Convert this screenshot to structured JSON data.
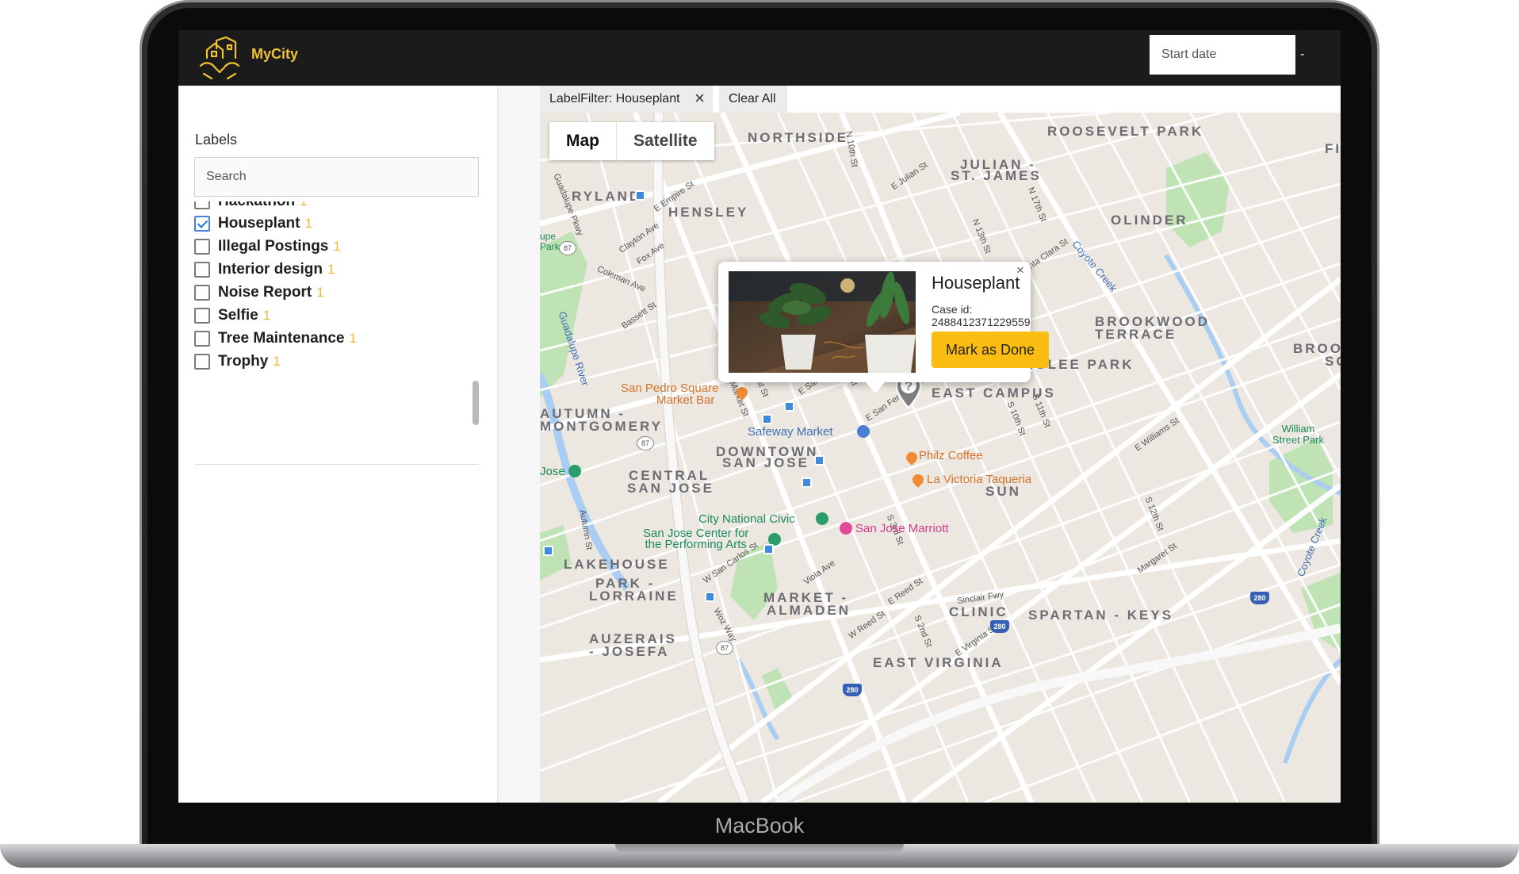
{
  "device": {
    "brand_label": "MacBook"
  },
  "header": {
    "app_name": "MyCity",
    "start_date_placeholder": "Start date",
    "date_separator": "-"
  },
  "sidebar": {
    "title": "Labels",
    "search_placeholder": "Search",
    "items": [
      {
        "label": "Hackathon",
        "count": "1",
        "checked": false
      },
      {
        "label": "Houseplant",
        "count": "1",
        "checked": true
      },
      {
        "label": "Illegal Postings",
        "count": "1",
        "checked": false
      },
      {
        "label": "Interior design",
        "count": "1",
        "checked": false
      },
      {
        "label": "Noise Report",
        "count": "1",
        "checked": false
      },
      {
        "label": "Selfie",
        "count": "1",
        "checked": false
      },
      {
        "label": "Tree Maintenance",
        "count": "1",
        "checked": false
      },
      {
        "label": "Trophy",
        "count": "1",
        "checked": false
      }
    ]
  },
  "filters": {
    "active_filter": "LabelFilter: Houseplant",
    "remove_icon": "×",
    "clear_all": "Clear All"
  },
  "map": {
    "map_type": {
      "map_label": "Map",
      "satellite_label": "Satellite",
      "selected": "Map"
    },
    "areas": [
      "NORTHSIDE",
      "ROOSEVELT PARK",
      "JULIAN -",
      "ST. JAMES",
      "RYLAND",
      "HENSLEY",
      "OLINDER",
      "BROOKWOOD",
      "TERRACE",
      "NAGLEE PARK",
      "EAST CAMPUS",
      "AUTUMN -",
      "MONTGOMERY",
      "DOWNTOWN",
      "SAN JOSE",
      "CENTRAL",
      "SAN JOSE",
      "SUN",
      "LAKEHOUSE",
      "PARK -",
      "LORRAINE",
      "MARKET -",
      "ALMADEN",
      "CLINIC",
      "SPARTAN - KEYS",
      "AUZERAIS",
      "- JOSEFA",
      "EAST VIRGINIA"
    ],
    "places": {
      "san_pedro_square": "San Pedro Square",
      "market_bar": "Market Bar",
      "safeway": "Safeway Market",
      "philz": "Philz Coffee",
      "la_victoria": "La Victoria Taqueria",
      "city_national": "City National Civic",
      "sj_center_1": "San Jose Center for",
      "sj_center_2": "the Performing Arts",
      "marriott": "San Jose Marriott",
      "william_park_1": "William",
      "william_park_2": "Street Park",
      "guadalupe_river": "Guadalupe River",
      "coyote_creek": "Coyote Creek",
      "coyote_creek_2": "Coyote Creek",
      "jose": "Jose",
      "park_partial": "upe Park",
      "brook_partial": "BROO",
      "so_partial": "SO",
      "fi_partial": "FI"
    },
    "streets": [
      "N 10th St",
      "E Julian St",
      "Guadalupe Pkwy",
      "E Empire St",
      "Clayton Ave",
      "Fox Ave",
      "Coleman Ave",
      "Bassett St",
      "Santa Clara St",
      "E Santa Clara St",
      "E San Fernando St",
      "N Market St",
      "N 1st St",
      "S 4th St",
      "S 10th St",
      "S 11th St",
      "E Williams St",
      "S 3rd St",
      "W San Carlos St",
      "Woz Way",
      "E Reed St",
      "Sinclair Fwy",
      "W Reed St",
      "S 2nd St",
      "E Virginia St",
      "Viola Ave",
      "Autumn St",
      "N 13th St",
      "N 17th St",
      "S 12th St",
      "Margaret St"
    ],
    "highways": [
      "87",
      "87",
      "87",
      "280",
      "280",
      "280"
    ],
    "marker_icon": "question-marker",
    "info_window": {
      "title": "Houseplant",
      "case_label": "Case id: 2488412371229559",
      "action": "Mark as Done",
      "close": "×"
    }
  },
  "colors": {
    "topbar": "#1c1b1b",
    "brand": "#f0c133",
    "count": "#f2b63a",
    "action_button": "#fcbd12",
    "map_land": "#ece7e0",
    "map_park": "#bfe3b5",
    "map_water": "#a9cdf3"
  }
}
